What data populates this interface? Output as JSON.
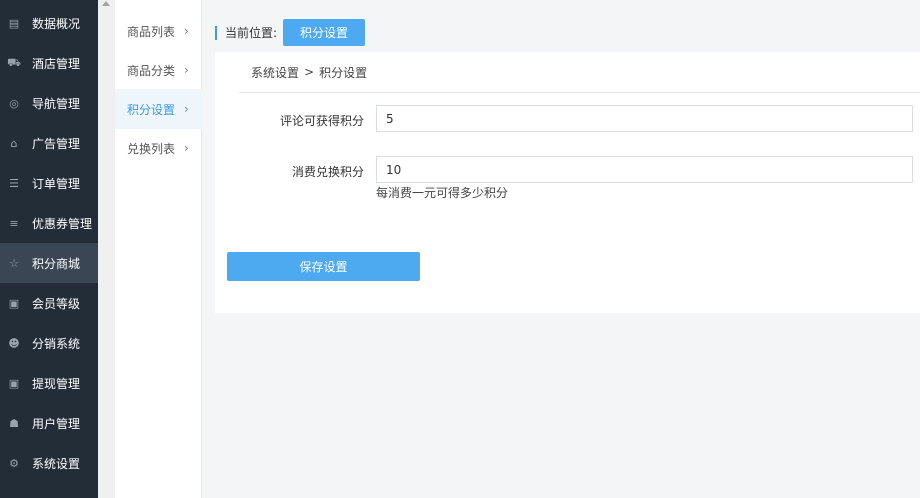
{
  "sidebar": {
    "items": [
      {
        "label": "数据概况",
        "icon": "▤"
      },
      {
        "label": "酒店管理",
        "icon": "⛟"
      },
      {
        "label": "导航管理",
        "icon": "◎"
      },
      {
        "label": "广告管理",
        "icon": "⌂"
      },
      {
        "label": "订单管理",
        "icon": "☰"
      },
      {
        "label": "优惠券管理",
        "icon": "≡"
      },
      {
        "label": "积分商城",
        "icon": "☆"
      },
      {
        "label": "会员等级",
        "icon": "▣"
      },
      {
        "label": "分销系统",
        "icon": "☻"
      },
      {
        "label": "提现管理",
        "icon": "▣"
      },
      {
        "label": "用户管理",
        "icon": "☗"
      },
      {
        "label": "系统设置",
        "icon": "⚙"
      }
    ]
  },
  "submenu": {
    "items": [
      {
        "label": "商品列表"
      },
      {
        "label": "商品分类"
      },
      {
        "label": "积分设置"
      },
      {
        "label": "兑换列表"
      }
    ],
    "chevron": "›"
  },
  "breadcrumb": {
    "prefix": "当前位置:",
    "current": "积分设置"
  },
  "panel": {
    "crumb_root": "系统设置",
    "crumb_sep": ">",
    "crumb_leaf": "积分设置"
  },
  "form": {
    "comment_points_label": "评论可获得积分",
    "comment_points_value": "5",
    "spend_exchange_label": "消费兑换积分",
    "spend_exchange_value": "10",
    "spend_exchange_hint": "每消费一元可得多少积分",
    "save_label": "保存设置"
  },
  "colors": {
    "sidebar_bg": "#232d38",
    "accent": "#4daaf0",
    "active_text": "#3a9ae8"
  }
}
